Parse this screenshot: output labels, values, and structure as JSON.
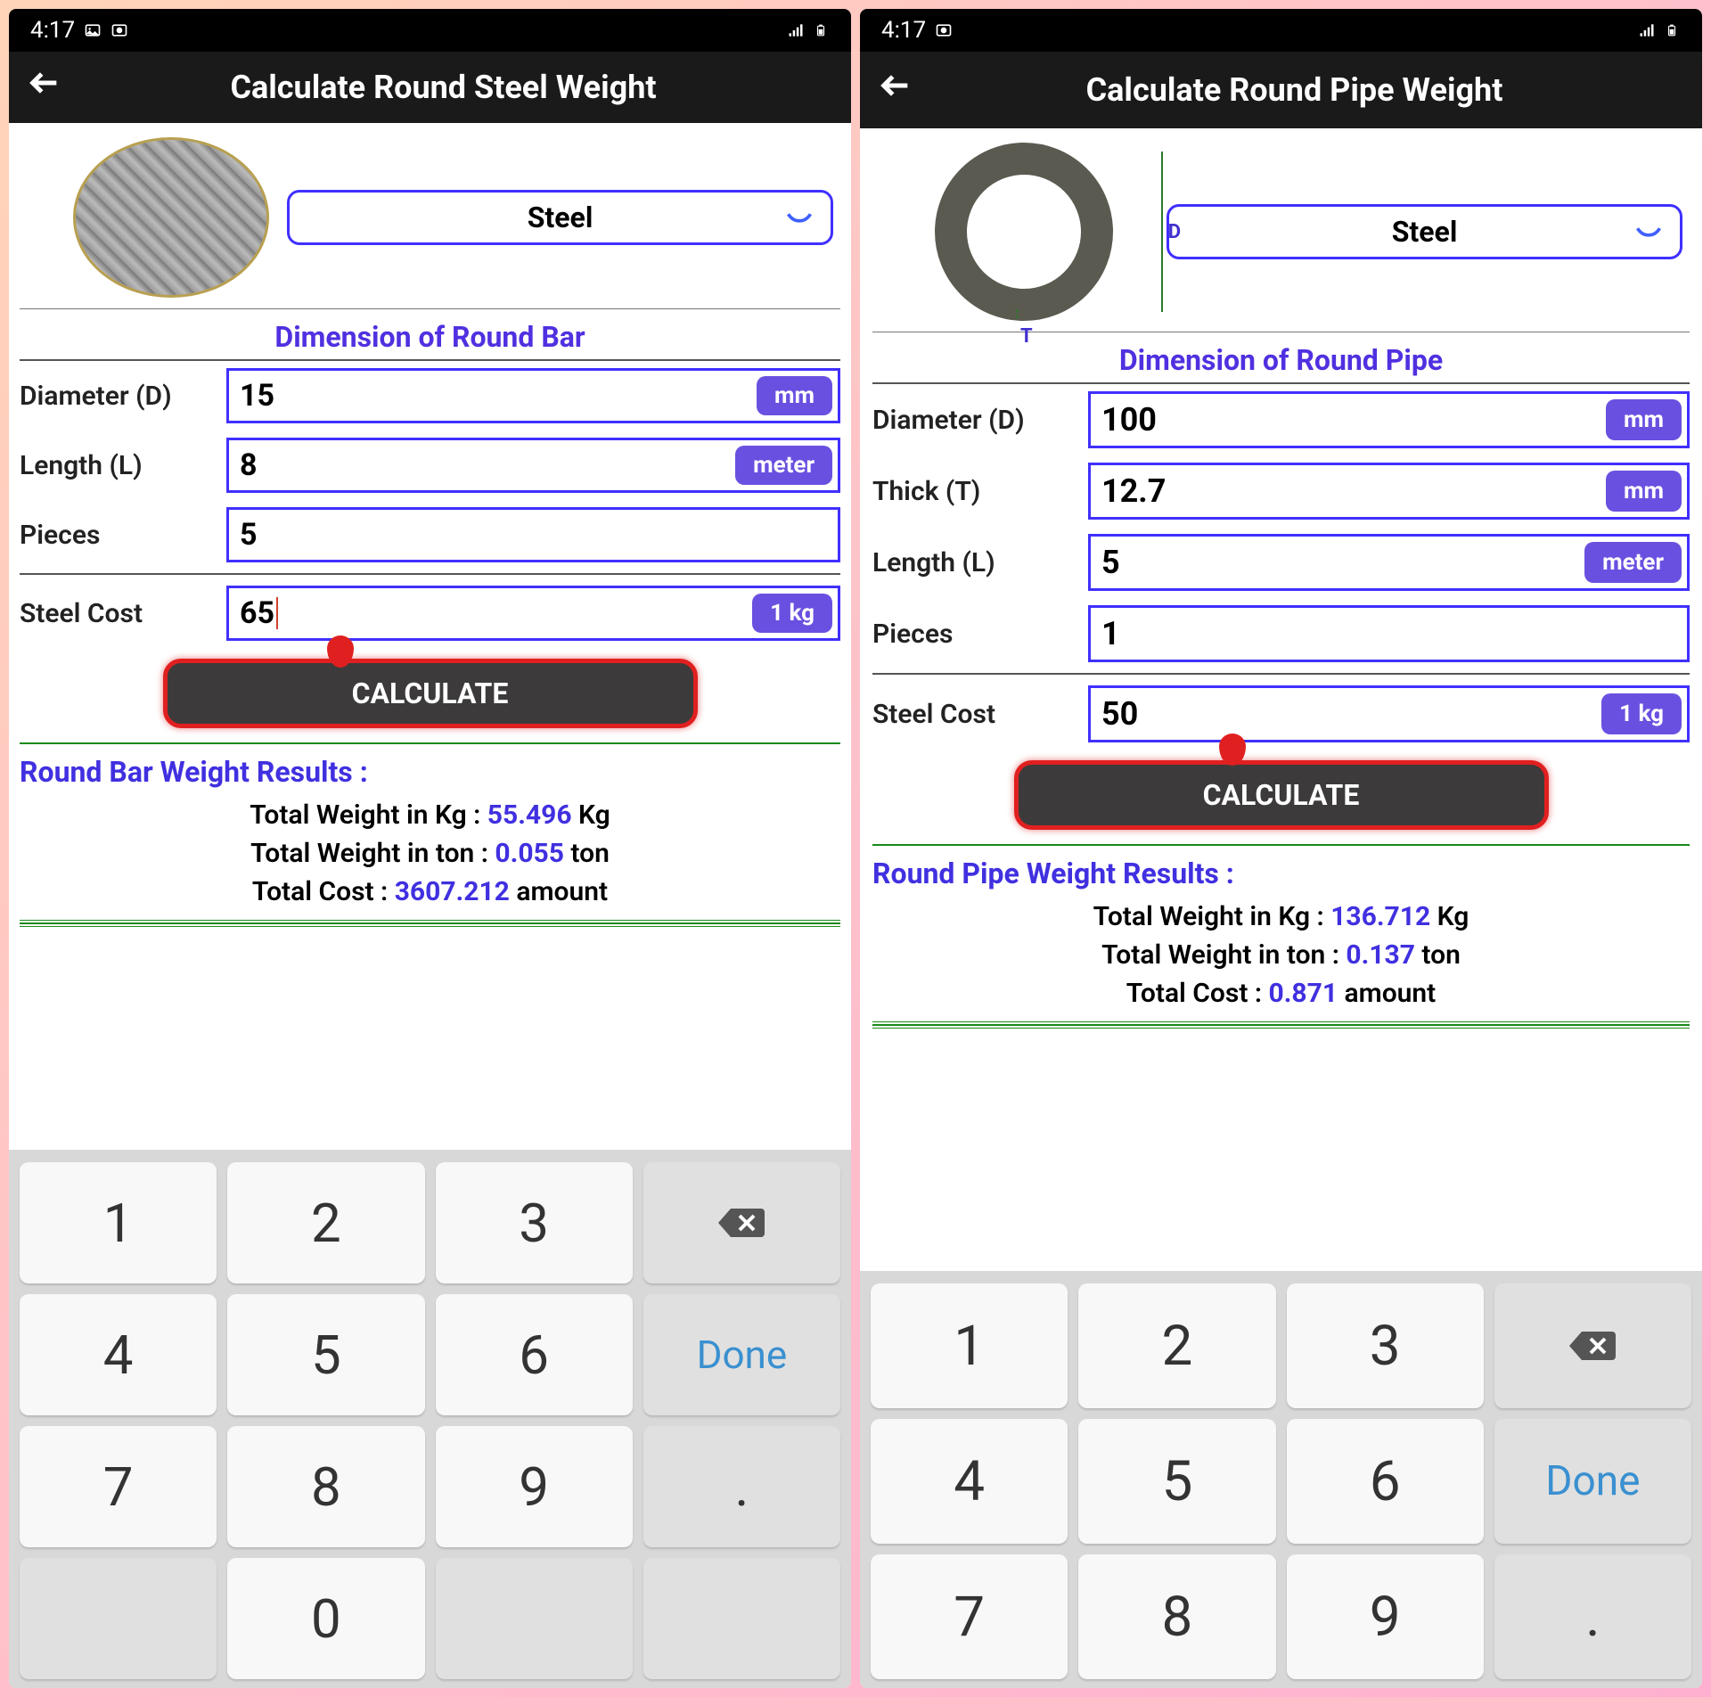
{
  "status": {
    "time": "4:17"
  },
  "left": {
    "title": "Calculate Round Steel Weight",
    "material": "Steel",
    "section": "Dimension of Round Bar",
    "fields": {
      "diameter": {
        "label": "Diameter (D)",
        "value": "15",
        "unit": "mm"
      },
      "length": {
        "label": "Length (L)",
        "value": "8",
        "unit": "meter"
      },
      "pieces": {
        "label": "Pieces",
        "value": "5"
      },
      "cost": {
        "label": "Steel Cost",
        "value": "65",
        "unit": "1 kg"
      }
    },
    "calculate": "CALCULATE",
    "results": {
      "title": "Round Bar Weight Results :",
      "kg_label": "Total Weight in Kg : ",
      "kg_val": "55.496",
      "kg_suffix": " Kg",
      "ton_label": "Total Weight in ton : ",
      "ton_val": "0.055",
      "ton_suffix": " ton",
      "cost_label": "Total Cost : ",
      "cost_val": "3607.212",
      "cost_suffix": " amount"
    }
  },
  "right": {
    "title": "Calculate Round Pipe Weight",
    "material": "Steel",
    "section": "Dimension of Round Pipe",
    "fields": {
      "diameter": {
        "label": "Diameter (D)",
        "value": "100",
        "unit": "mm"
      },
      "thick": {
        "label": "Thick (T)",
        "value": "12.7",
        "unit": "mm"
      },
      "length": {
        "label": "Length (L)",
        "value": "5",
        "unit": "meter"
      },
      "pieces": {
        "label": "Pieces",
        "value": "1"
      },
      "cost": {
        "label": "Steel Cost",
        "value": "50",
        "unit": "1 kg"
      }
    },
    "calculate": "CALCULATE",
    "results": {
      "title": "Round Pipe Weight Results :",
      "kg_label": "Total Weight in Kg : ",
      "kg_val": "136.712",
      "kg_suffix": " Kg",
      "ton_label": "Total Weight in ton : ",
      "ton_val": "0.137",
      "ton_suffix": " ton",
      "cost_label": "Total Cost : ",
      "cost_val": "0.871",
      "cost_suffix": " amount"
    }
  },
  "keyboard": {
    "k1": "1",
    "k2": "2",
    "k3": "3",
    "k4": "4",
    "k5": "5",
    "k6": "6",
    "k7": "7",
    "k8": "8",
    "k9": "9",
    "k0": "0",
    "dot": ".",
    "done": "Done"
  }
}
